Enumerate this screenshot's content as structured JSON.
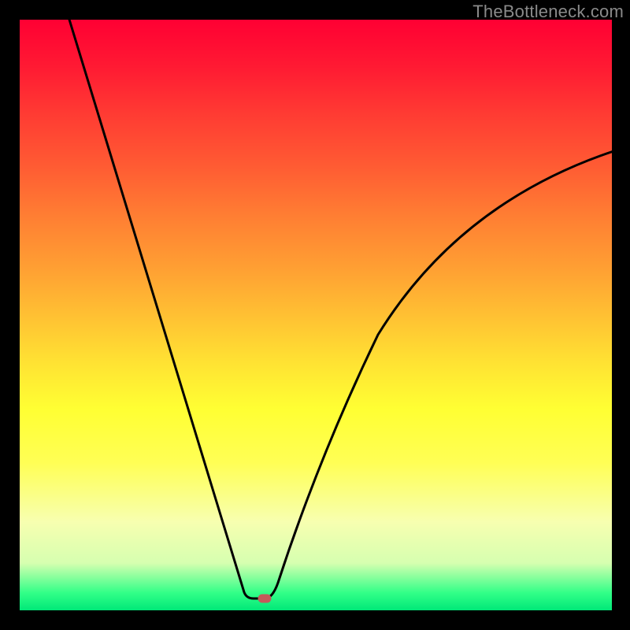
{
  "watermark": "TheBottleneck.com",
  "colors": {
    "frame": "#000000",
    "gradient_top": "#ff0033",
    "gradient_mid": "#ffff33",
    "gradient_bottom": "#00e878",
    "curve": "#000000",
    "marker": "#c45a5a",
    "watermark": "#8a8a8a"
  },
  "chart_data": {
    "type": "line",
    "title": "",
    "xlabel": "",
    "ylabel": "",
    "xlim": [
      0,
      100
    ],
    "ylim": [
      0,
      100
    ],
    "series": [
      {
        "name": "bottleneck-curve",
        "x": [
          8,
          15,
          22,
          29,
          34,
          38,
          40,
          41,
          42,
          45,
          50,
          58,
          68,
          80,
          92,
          100
        ],
        "values": [
          100,
          80,
          60,
          40,
          20,
          6,
          2,
          2,
          2,
          10,
          30,
          50,
          65,
          73,
          77,
          78
        ]
      }
    ],
    "annotations": [
      {
        "name": "optimal-point",
        "x": 41,
        "y": 2,
        "shape": "rounded-rect",
        "color": "#c45a5a"
      }
    ],
    "background": {
      "type": "vertical-gradient",
      "stops": [
        {
          "pos": 0.0,
          "color": "#ff0033"
        },
        {
          "pos": 0.5,
          "color": "#ffc033"
        },
        {
          "pos": 0.66,
          "color": "#ffff33"
        },
        {
          "pos": 1.0,
          "color": "#00e878"
        }
      ],
      "meaning": "red=high bottleneck, green=low bottleneck"
    }
  }
}
